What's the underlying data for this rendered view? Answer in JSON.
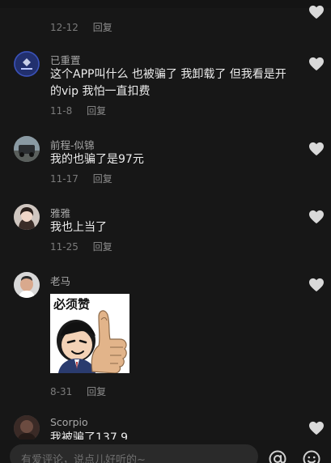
{
  "comments": [
    {
      "date": "12-12",
      "reply_label": "回复"
    },
    {
      "username": "已重置",
      "text": "这个APP叫什么 也被骗了 我卸载了 但我看是开的vip 我怕一直扣费",
      "date": "11-8",
      "reply_label": "回复"
    },
    {
      "username": "前程-似锦",
      "text": "我的也骗了是97元",
      "date": "11-17",
      "reply_label": "回复"
    },
    {
      "username": "雅雅",
      "text": "我也上当了",
      "date": "11-25",
      "reply_label": "回复"
    },
    {
      "username": "老马",
      "sticker_text": "必须赞",
      "date": "8-31",
      "reply_label": "回复"
    },
    {
      "username": "Scorpio",
      "text": "我被骗了137 9"
    }
  ],
  "input": {
    "placeholder": "有爱评论，说点儿好听的~"
  },
  "icons": {
    "like": "heart-icon",
    "mention": "at-icon",
    "emoji": "smiley-icon"
  },
  "colors": {
    "background": "#171717",
    "text": "#ececec",
    "secondary": "#7b7b7b",
    "heart": "#d9d9d9"
  }
}
